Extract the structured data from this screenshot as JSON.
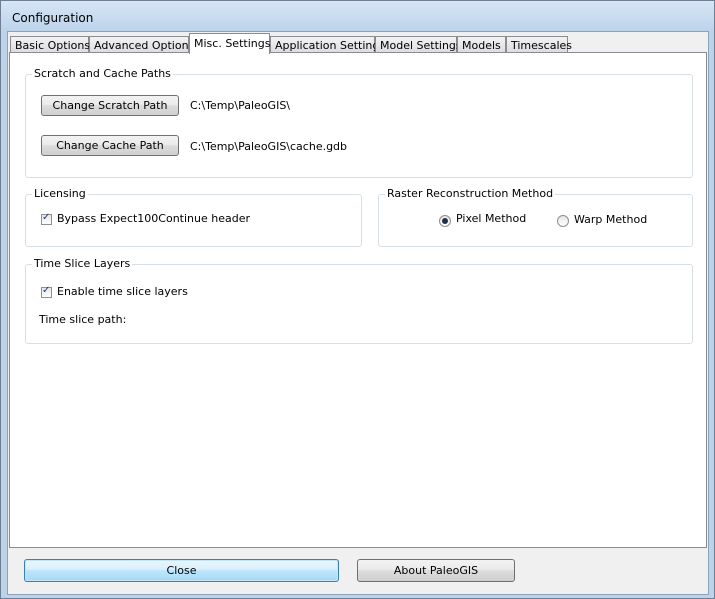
{
  "window": {
    "title": "Configuration"
  },
  "tabs": [
    {
      "label": "Basic Options"
    },
    {
      "label": "Advanced Options"
    },
    {
      "label": "Misc. Settings",
      "active": true
    },
    {
      "label": "Application Settings"
    },
    {
      "label": "Model Settings"
    },
    {
      "label": "Models"
    },
    {
      "label": "Timescales"
    }
  ],
  "scratch_cache": {
    "legend": "Scratch and Cache Paths",
    "scratch_button": "Change Scratch Path",
    "scratch_path": "C:\\Temp\\PaleoGIS\\",
    "cache_button": "Change Cache Path",
    "cache_path": "C:\\Temp\\PaleoGIS\\cache.gdb"
  },
  "licensing": {
    "legend": "Licensing",
    "bypass_label": "Bypass Expect100Continue header",
    "bypass_checked": true
  },
  "raster": {
    "legend": "Raster Reconstruction Method",
    "pixel_label": "Pixel Method",
    "warp_label": "Warp Method",
    "selected": "Pixel Method"
  },
  "time_slice": {
    "legend": "Time Slice Layers",
    "enable_label": "Enable time slice layers",
    "enable_checked": true,
    "path_label": "Time slice path:"
  },
  "footer": {
    "close_label": "Close",
    "about_label": "About PaleoGIS"
  }
}
